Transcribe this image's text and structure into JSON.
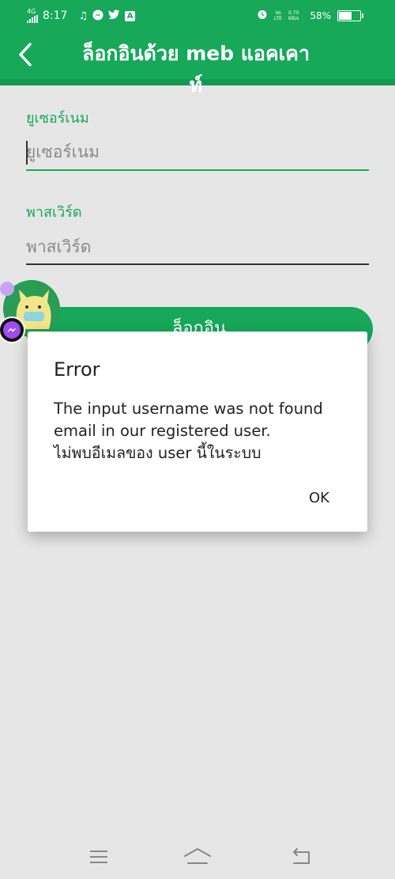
{
  "status_bar": {
    "network": "4G",
    "time": "8:17",
    "volte": "Vo",
    "lte": "LTE",
    "speed_value": "0.70",
    "speed_unit": "KB/s",
    "battery": "58%",
    "battery_level": 0.58,
    "app_badge": "A"
  },
  "app_bar": {
    "title": "ล็อกอินด้วย meb แอคเคาท์",
    "back_icon": "chevron-left-icon"
  },
  "form": {
    "username_label": "ยูเซอร์เนม",
    "username_placeholder": "ยูเซอร์เนม",
    "password_label": "พาสเวิร์ด",
    "password_placeholder": "พาสเวิร์ด",
    "login_label": "ล็อกอิน"
  },
  "dialog": {
    "title": "Error",
    "message_lines": [
      "The input username was not found",
      "email in our registered user.",
      "ไม่พบอีเมลของ user นี้ในระบบ"
    ],
    "ok_label": "OK"
  },
  "nav_bar": {
    "icons": [
      "menu-icon",
      "home-icon",
      "back-icon"
    ]
  },
  "colors": {
    "brand": "#17a85a",
    "background": "#e6e6e6"
  }
}
